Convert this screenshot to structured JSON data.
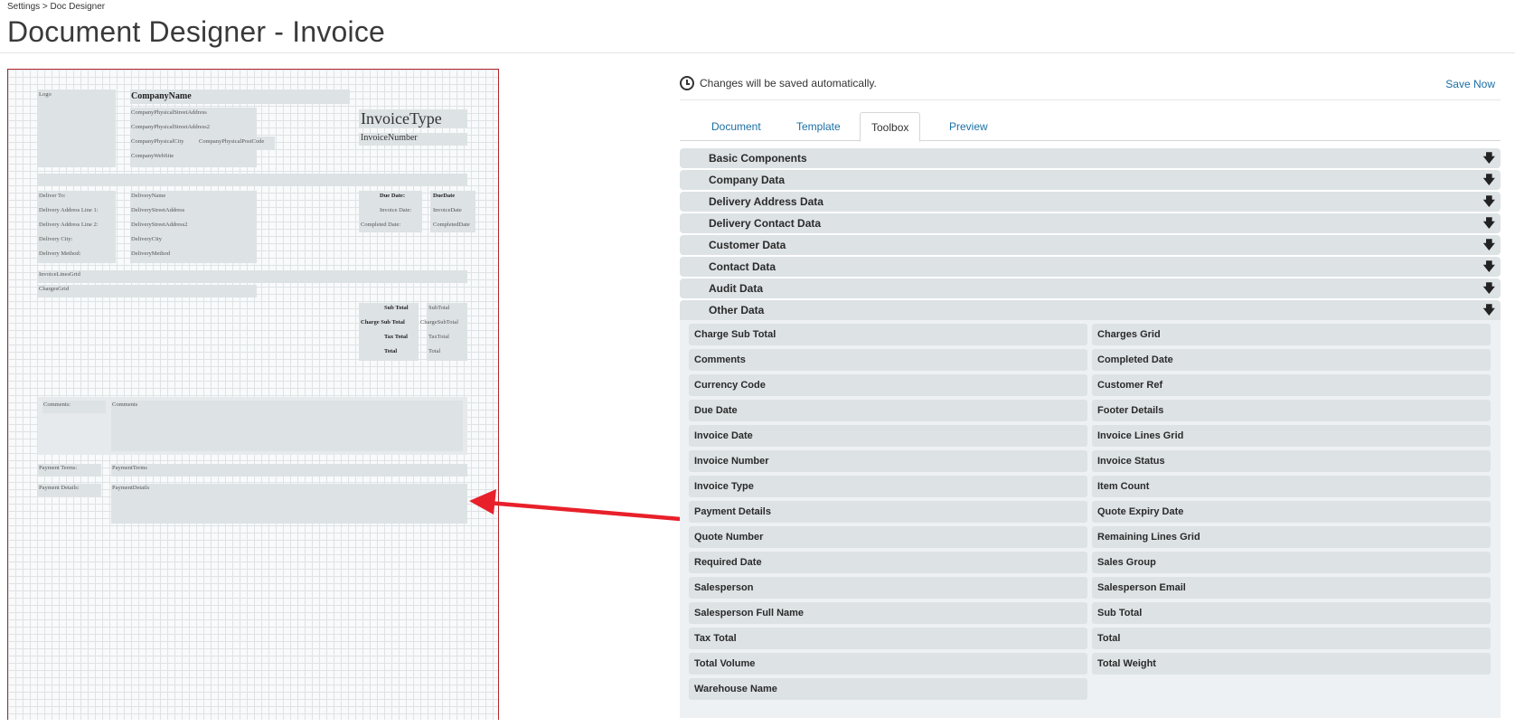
{
  "breadcrumb": "Settings > Doc Designer",
  "page_title": "Document Designer - Invoice",
  "canvas": {
    "logo": "Logo",
    "company_name": "CompanyName",
    "company_street": "CompanyPhysicalStreetAddress",
    "company_street2": "CompanyPhysicalStreetAddress2",
    "company_city": "CompanyPhysicalCity",
    "company_postcode": "CompanyPhysicalPostCode",
    "company_website": "CompanyWebSite",
    "invoice_type": "InvoiceType",
    "invoice_number": "InvoiceNumber",
    "deliver_to_label": "Deliver To:",
    "delivery_line1_label": "Delivery Address Line 1:",
    "delivery_line2_label": "Delivery Address Line 2:",
    "delivery_city_label": "Delivery City:",
    "delivery_method_label": "Delivery Method:",
    "delivery_name": "DeliveryName",
    "delivery_street": "DeliveryStreetAddress",
    "delivery_street2": "DeliveryStreetAddress2",
    "delivery_city": "DeliveryCity",
    "delivery_method": "DeliveryMethod",
    "due_date_label": "Due Date:",
    "due_date": "DueDate",
    "invoice_date_label": "Invoice Date:",
    "invoice_date": "InvoiceDate",
    "completed_date_label": "Completed Date:",
    "completed_date": "CompletedDate",
    "invoice_lines_grid": "InvoiceLinesGrid",
    "charges_grid": "ChargesGrid",
    "sub_total_label": "Sub Total",
    "sub_total": "SubTotal",
    "charge_sub_total_label": "Charge Sub Total",
    "charge_sub_total": "ChargeSubTotal",
    "tax_total_label": "Tax Total",
    "tax_total": "TaxTotal",
    "total_label": "Total",
    "total": "Total",
    "comments_label": "Comments:",
    "comments": "Comments",
    "payment_terms_label": "Payment Terms:",
    "payment_terms": "PaymentTerms",
    "payment_details_label": "Payment Details:",
    "payment_details": "PaymentDetails"
  },
  "panel": {
    "autosave_text": "Changes will be saved automatically.",
    "save_now": "Save Now",
    "tabs": [
      "Document",
      "Template",
      "Toolbox",
      "Preview"
    ],
    "active_tab": "Toolbox",
    "sections": [
      "Basic Components",
      "Company Data",
      "Delivery Address Data",
      "Delivery Contact Data",
      "Customer Data",
      "Contact Data",
      "Audit Data",
      "Other Data"
    ],
    "items": [
      "Charge Sub Total",
      "Charges Grid",
      "Comments",
      "Completed Date",
      "Currency Code",
      "Customer Ref",
      "Due Date",
      "Footer Details",
      "Invoice Date",
      "Invoice Lines Grid",
      "Invoice Number",
      "Invoice Status",
      "Invoice Type",
      "Item Count",
      "Payment Details",
      "Quote Expiry Date",
      "Quote Number",
      "Remaining Lines Grid",
      "Required Date",
      "Sales Group",
      "Salesperson",
      "Salesperson Email",
      "Salesperson Full Name",
      "Sub Total",
      "Tax Total",
      "Total",
      "Total Volume",
      "Total Weight",
      "Warehouse Name"
    ]
  },
  "colors": {
    "canvas_border": "#b3262b",
    "arrow": "#e8202a",
    "link": "#1b6fa3",
    "block": "#dde2e5"
  }
}
